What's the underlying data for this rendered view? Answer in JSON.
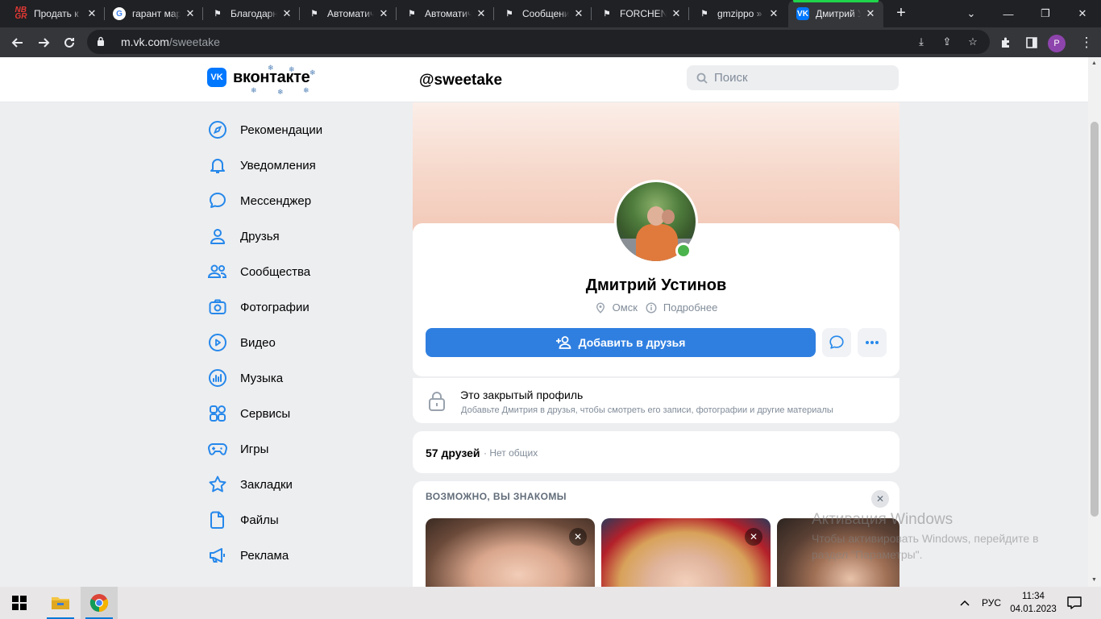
{
  "browser": {
    "tabs": [
      {
        "title": "Продать к",
        "favicon": "nbgr-favicon"
      },
      {
        "title": "гарант мар",
        "favicon": "google-favicon"
      },
      {
        "title": "Благодарн",
        "favicon": "flag-favicon"
      },
      {
        "title": "Автоматич",
        "favicon": "flag-favicon"
      },
      {
        "title": "Автоматич",
        "favicon": "flag-favicon"
      },
      {
        "title": "Сообщени",
        "favicon": "flag-favicon"
      },
      {
        "title": "FORCHENI",
        "favicon": "flag-favicon"
      },
      {
        "title": "gmzippo »",
        "favicon": "flag-favicon"
      },
      {
        "title": "Дмитрий У",
        "favicon": "vk-favicon",
        "active": true
      }
    ],
    "url_host": "m.vk.com",
    "url_path": "/sweetake",
    "profile_initial": "P"
  },
  "vk": {
    "logo_text": "вконтакте",
    "logo_mark": "VK",
    "handle": "@sweetake",
    "search_placeholder": "Поиск",
    "menu": [
      {
        "label": "Рекомендации",
        "icon": "compass-icon"
      },
      {
        "label": "Уведомления",
        "icon": "bell-icon"
      },
      {
        "label": "Мессенджер",
        "icon": "chat-icon"
      },
      {
        "label": "Друзья",
        "icon": "user-icon"
      },
      {
        "label": "Сообщества",
        "icon": "users-icon"
      },
      {
        "label": "Фотографии",
        "icon": "camera-icon"
      },
      {
        "label": "Видео",
        "icon": "play-icon"
      },
      {
        "label": "Музыка",
        "icon": "music-icon"
      },
      {
        "label": "Сервисы",
        "icon": "services-icon"
      },
      {
        "label": "Игры",
        "icon": "gamepad-icon"
      },
      {
        "label": "Закладки",
        "icon": "star-icon"
      },
      {
        "label": "Файлы",
        "icon": "file-icon"
      },
      {
        "label": "Реклама",
        "icon": "megaphone-icon"
      }
    ],
    "profile": {
      "name": "Дмитрий Устинов",
      "city": "Омск",
      "details_link": "Подробнее",
      "add_friend_label": "Добавить в друзья",
      "online": true
    },
    "closed_profile": {
      "title": "Это закрытый профиль",
      "subtitle": "Добавьте Дмитрия в друзья, чтобы смотреть его записи, фотографии и другие материалы"
    },
    "friends": {
      "count_label": "57 друзей",
      "common_label": "· Нет общих"
    },
    "suggestions": {
      "title": "ВОЗМОЖНО, ВЫ ЗНАКОМЫ"
    }
  },
  "watermark": {
    "line1": "Активация Windows",
    "line2": "Чтобы активировать Windows, перейдите в раздел \"Параметры\"."
  },
  "taskbar": {
    "language": "РУС",
    "time": "11:34",
    "date": "04.01.2023"
  },
  "colors": {
    "vk_blue": "#0077ff",
    "button_blue": "#2f7fe0",
    "online_green": "#4bb34b",
    "icon_blue": "#2688eb"
  }
}
